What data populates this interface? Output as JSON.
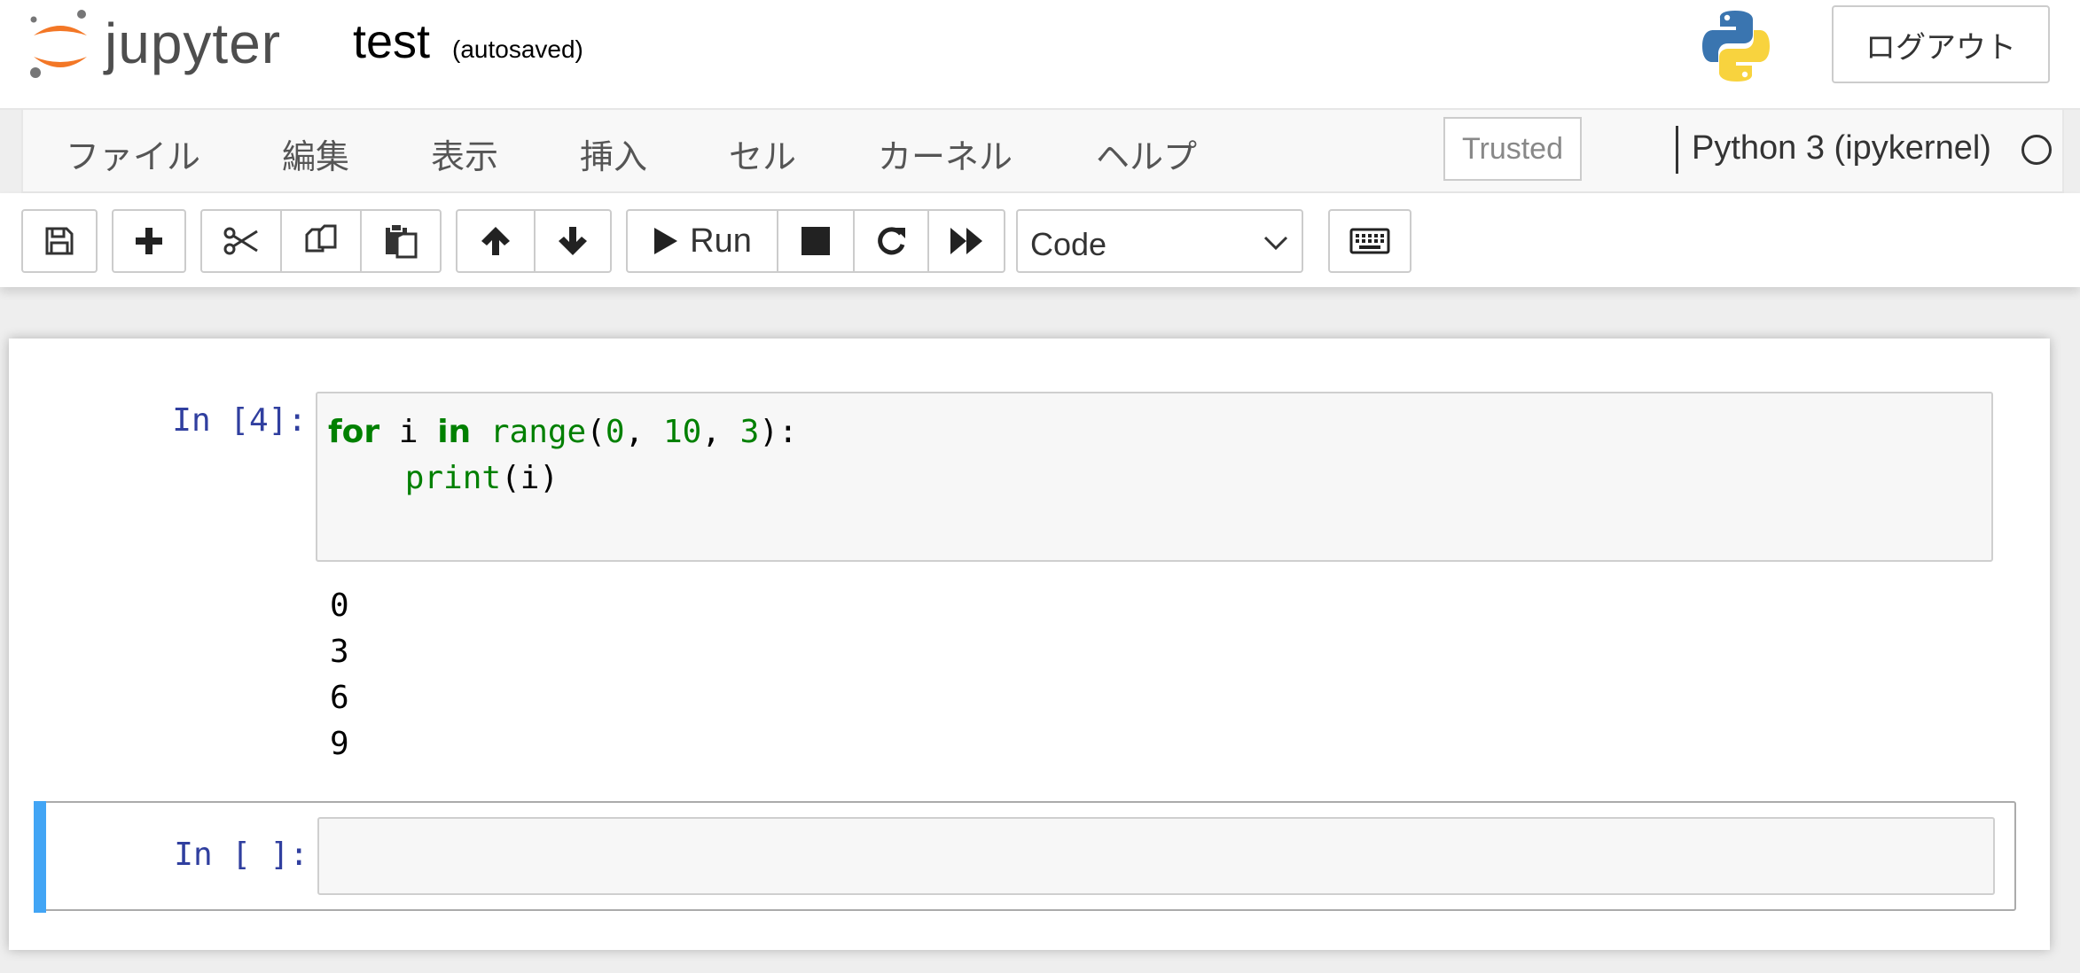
{
  "header": {
    "logo_text": "jupyter",
    "notebook_name": "test",
    "autosave_status": "(autosaved)",
    "logout_label": "ログアウト",
    "kernel_logo": "python-logo-icon"
  },
  "menubar": {
    "items": [
      "ファイル",
      "編集",
      "表示",
      "挿入",
      "セル",
      "カーネル",
      "ヘルプ"
    ],
    "trusted_label": "Trusted",
    "kernel_name": "Python 3 (ipykernel)",
    "kernel_status_icon": "kernel-idle-circle-icon"
  },
  "toolbar": {
    "icons": [
      "save-icon",
      "plus-icon",
      "scissors-icon",
      "copy-icon",
      "paste-icon",
      "arrow-up-icon",
      "arrow-down-icon",
      "play-icon",
      "stop-icon",
      "restart-icon",
      "fast-forward-icon",
      "keyboard-icon"
    ],
    "run_label": "Run",
    "cell_type": "Code"
  },
  "cells": [
    {
      "prompt": "In [4]:",
      "code_lines": [
        [
          [
            "for",
            "kw"
          ],
          [
            " i ",
            "tx"
          ],
          [
            "in",
            "kw"
          ],
          [
            " ",
            "tx"
          ],
          [
            "range",
            "bi"
          ],
          [
            "(",
            "tx"
          ],
          [
            "0",
            "num"
          ],
          [
            ", ",
            "tx"
          ],
          [
            "10",
            "num"
          ],
          [
            ", ",
            "tx"
          ],
          [
            "3",
            "num"
          ],
          [
            "):",
            "tx"
          ]
        ],
        [
          [
            "    ",
            "tx"
          ],
          [
            "print",
            "bi"
          ],
          [
            "(i)",
            "tx"
          ]
        ]
      ],
      "output": "0\n3\n6\n9"
    },
    {
      "prompt": "In [ ]:",
      "code_lines": [],
      "output": ""
    }
  ],
  "colors": {
    "prompt": "#303f9f",
    "selected_cell_bar": "#42a5f5",
    "keyword": "#008000"
  }
}
